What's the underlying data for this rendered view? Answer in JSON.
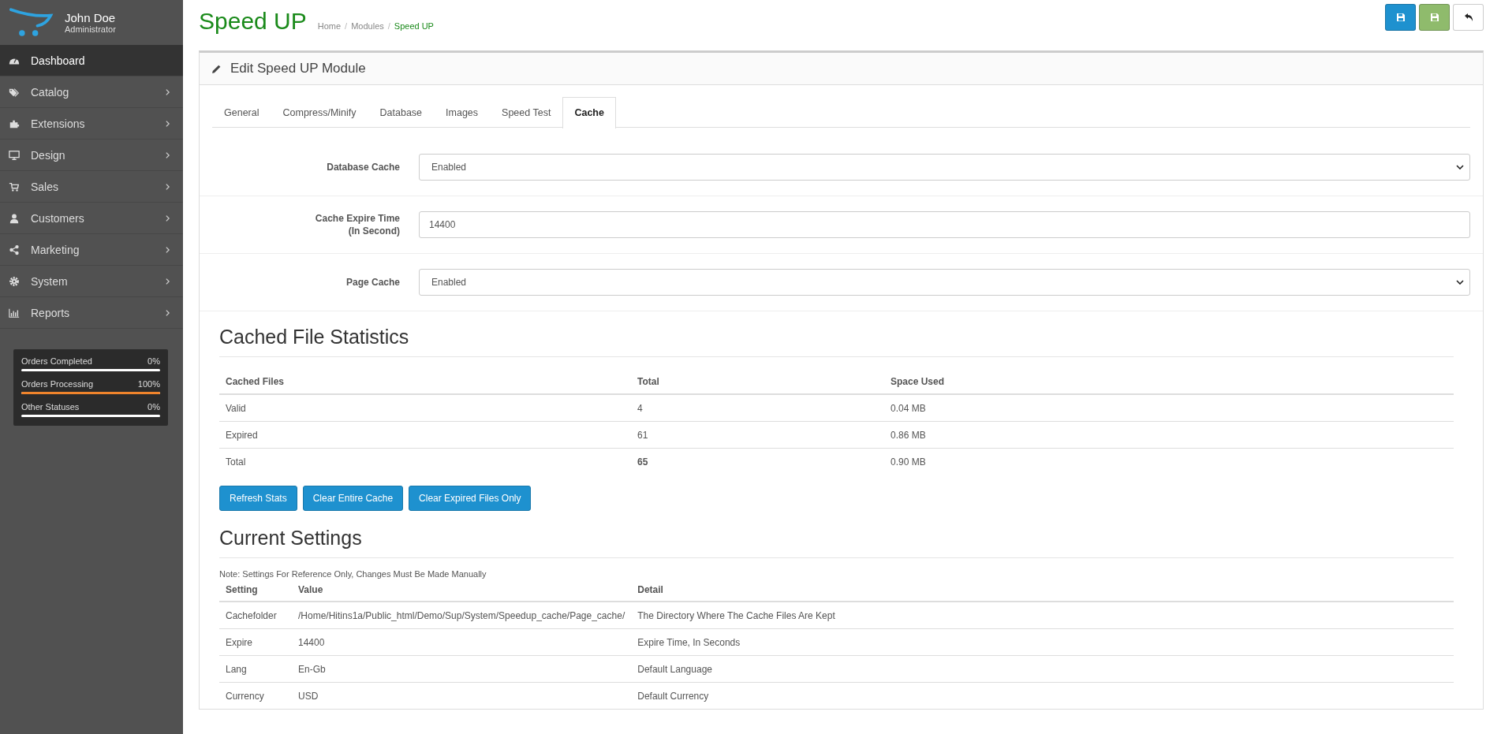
{
  "user": {
    "name": "John Doe",
    "role": "Administrator"
  },
  "menu": [
    {
      "label": "Dashboard",
      "selected": true,
      "expandable": false
    },
    {
      "label": "Catalog",
      "selected": false,
      "expandable": true
    },
    {
      "label": "Extensions",
      "selected": false,
      "expandable": true
    },
    {
      "label": "Design",
      "selected": false,
      "expandable": true
    },
    {
      "label": "Sales",
      "selected": false,
      "expandable": true
    },
    {
      "label": "Customers",
      "selected": false,
      "expandable": true
    },
    {
      "label": "Marketing",
      "selected": false,
      "expandable": true
    },
    {
      "label": "System",
      "selected": false,
      "expandable": true
    },
    {
      "label": "Reports",
      "selected": false,
      "expandable": true
    }
  ],
  "order_stats": [
    {
      "label": "Orders Completed",
      "reading": "0%",
      "level": 0
    },
    {
      "label": "Orders Processing",
      "reading": "100%",
      "level": 1
    },
    {
      "label": "Other Statuses",
      "reading": "0%",
      "level": 0
    }
  ],
  "page": {
    "title": "Speed UP",
    "breadcrumb": [
      {
        "label": "Home",
        "selected": false
      },
      {
        "separator": "/",
        "label": "Modules",
        "selected": false
      },
      {
        "separator": "/",
        "label": "Speed UP",
        "selected": true
      }
    ]
  },
  "header_actions": [
    {
      "kind": "save",
      "color": "#1e91cf"
    },
    {
      "kind": "save",
      "color": "#8fbb6c"
    },
    {
      "kind": "back",
      "color": "#ffffff"
    }
  ],
  "panel": {
    "title": "Edit Speed UP Module",
    "tabs": [
      {
        "label": "General",
        "selected": false
      },
      {
        "label": "Compress/Minify",
        "selected": false
      },
      {
        "label": "Database",
        "selected": false
      },
      {
        "label": "Images",
        "selected": false
      },
      {
        "label": "Speed Test",
        "selected": false
      },
      {
        "label": "Cache",
        "selected": true
      }
    ],
    "fields": [
      {
        "label": "Database Cache",
        "kind": "select",
        "value": "Enabled"
      },
      {
        "label": "Cache Expire Time",
        "label_line_2": "(In Second)",
        "kind": "input",
        "value": "14400"
      },
      {
        "label": "Page Cache",
        "kind": "select",
        "value": "Enabled"
      }
    ],
    "stats": {
      "heading": "Cached File Statistics",
      "columns": [
        "Cached Files",
        "Total",
        "Space Used"
      ],
      "rows": [
        [
          {
            "text": "Valid",
            "bold": false
          },
          {
            "text": "4",
            "bold": false
          },
          {
            "text": "0.04 MB",
            "bold": false
          }
        ],
        [
          {
            "text": "Expired",
            "bold": false
          },
          {
            "text": "61",
            "bold": false
          },
          {
            "text": "0.86 MB",
            "bold": false
          }
        ],
        [
          {
            "text": "Total",
            "bold": false
          },
          {
            "text": "65",
            "bold": true
          },
          {
            "text": "0.90 MB",
            "bold": false
          }
        ]
      ],
      "buttons": [
        "Refresh Stats",
        "Clear Entire Cache",
        "Clear Expired Files Only"
      ]
    },
    "settings": {
      "heading": "Current Settings",
      "note": "Note: Settings For Reference Only, Changes Must Be Made Manually",
      "columns": [
        "Setting",
        "Value",
        "Detail"
      ],
      "rows": [
        [
          "Cachefolder",
          "/Home/Hitins1a/Public_html/Demo/Sup/System/Speedup_cache/Page_cache/",
          "The Directory Where The Cache Files Are Kept"
        ],
        [
          "Expire",
          "14400",
          "Expire Time, In Seconds"
        ],
        [
          "Lang",
          "En-Gb",
          "Default Language"
        ],
        [
          "Currency",
          "USD",
          "Default Currency"
        ]
      ]
    }
  }
}
